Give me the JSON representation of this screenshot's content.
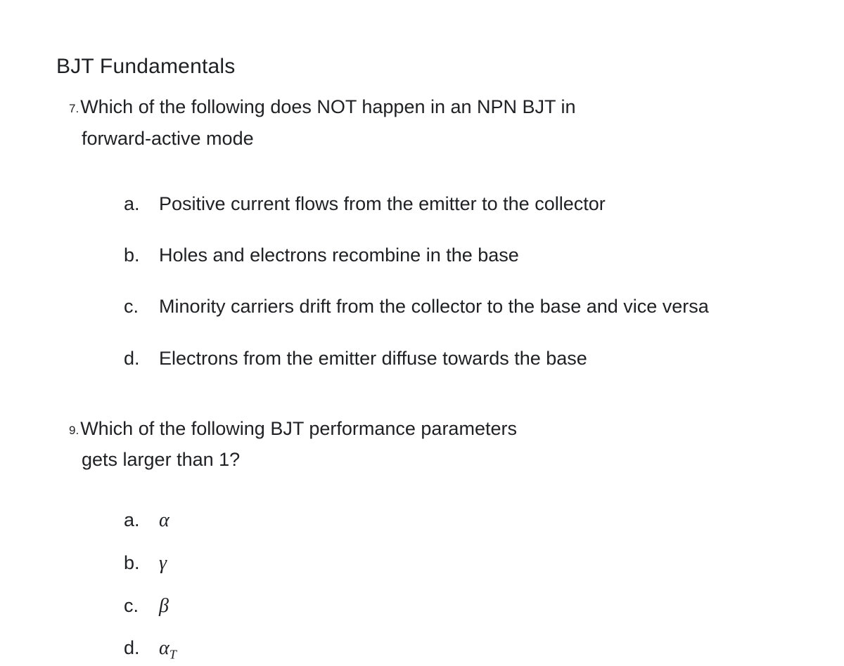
{
  "section_title": "BJT Fundamentals",
  "questions": [
    {
      "number": "7.",
      "text_line1": "Which of the following does NOT happen in an NPN BJT in",
      "text_line2": "forward-active mode",
      "options": [
        {
          "label": "a.",
          "text": "Positive current flows from the emitter to the collector"
        },
        {
          "label": "b.",
          "text": "Holes and electrons recombine in the base"
        },
        {
          "label": "c.",
          "text": "Minority carriers drift from the collector to the base and vice versa"
        },
        {
          "label": "d.",
          "text": "Electrons from the emitter diffuse towards the base"
        }
      ]
    },
    {
      "number": "9.",
      "text_line1": "Which of the following BJT performance parameters",
      "text_line2": "gets larger than 1?",
      "options": [
        {
          "label": "a.",
          "symbol": "α"
        },
        {
          "label": "b.",
          "symbol": "γ"
        },
        {
          "label": "c.",
          "symbol": "β"
        },
        {
          "label": "d.",
          "symbol": "α",
          "sub": "T"
        }
      ]
    }
  ]
}
